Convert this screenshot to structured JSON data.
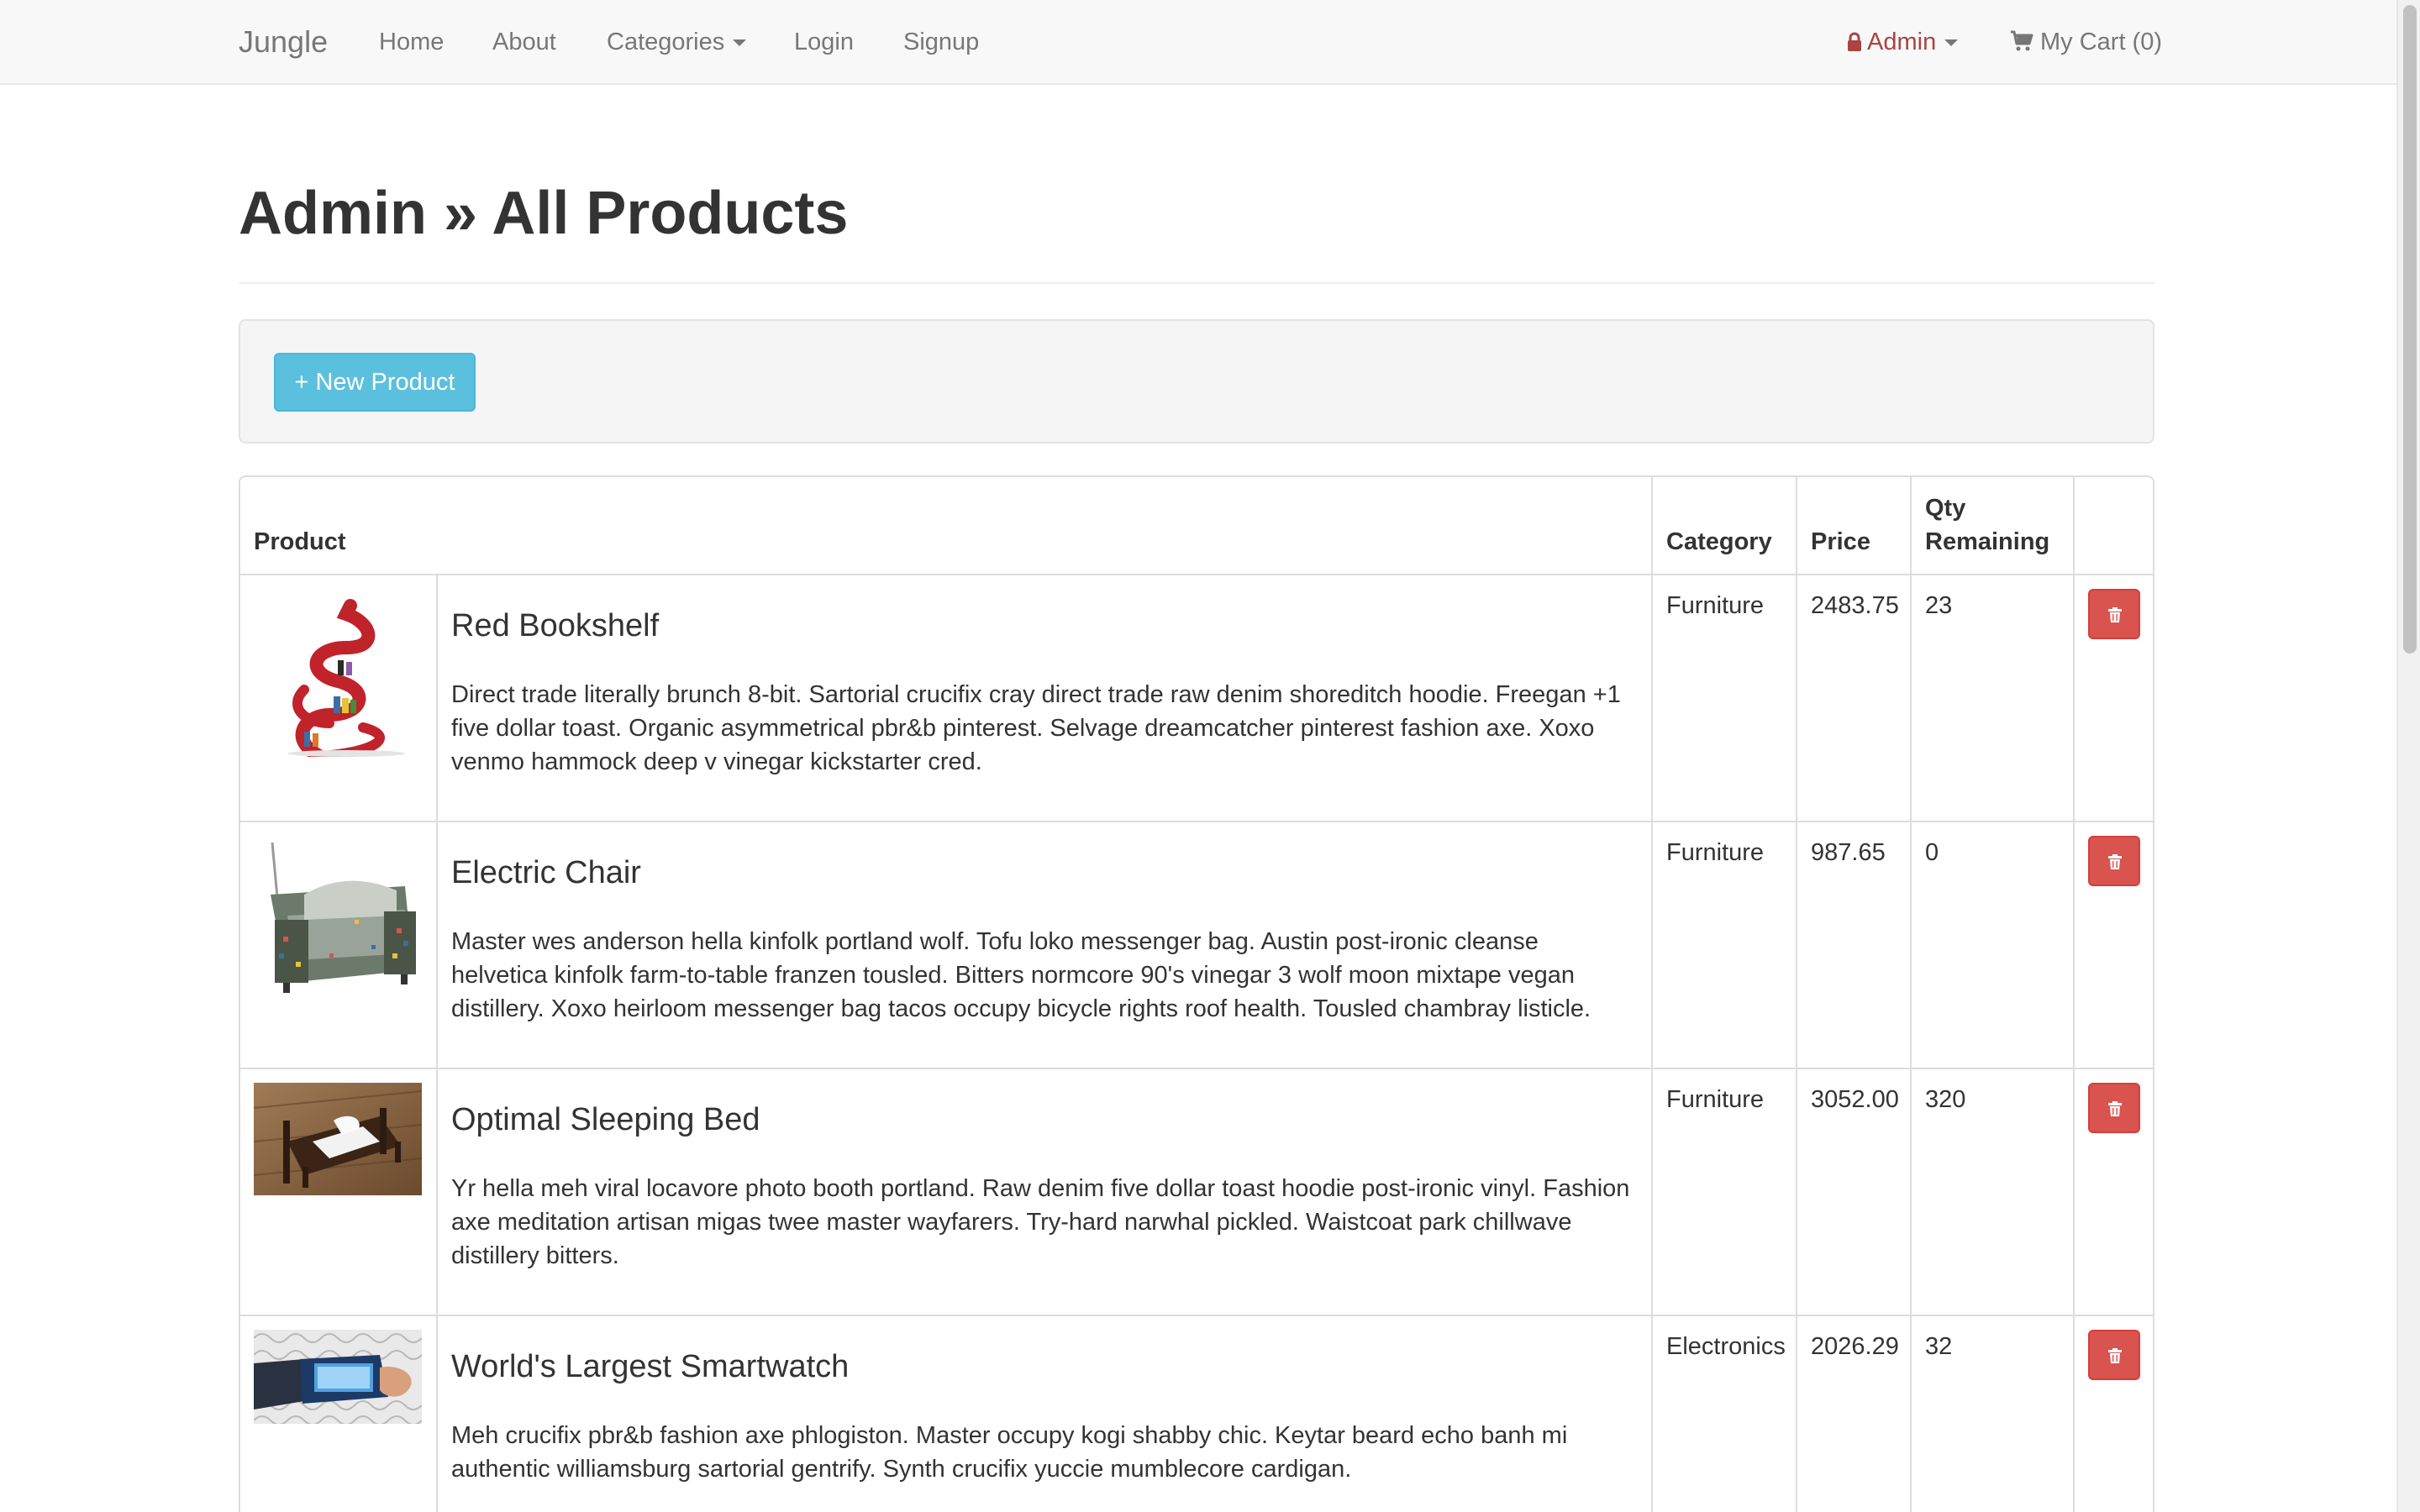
{
  "navbar": {
    "brand": "Jungle",
    "items": [
      {
        "label": "Home"
      },
      {
        "label": "About"
      },
      {
        "label": "Categories"
      },
      {
        "label": "Login"
      },
      {
        "label": "Signup"
      }
    ],
    "admin_label": "Admin",
    "cart_label": "My Cart (0)",
    "admin_color": "#a94442"
  },
  "page": {
    "title": "Admin » All Products"
  },
  "actions": {
    "new_product_label": "+ New Product"
  },
  "table": {
    "headers": {
      "product": "Product",
      "category": "Category",
      "price": "Price",
      "qty": "Qty Remaining"
    },
    "rows": [
      {
        "image_icon": "red-bookshelf-image",
        "name": "Red Bookshelf",
        "description": "Direct trade literally brunch 8-bit. Sartorial crucifix cray direct trade raw denim shoreditch hoodie. Freegan +1 five dollar toast. Organic asymmetrical pbr&b pinterest. Selvage dreamcatcher pinterest fashion axe. Xoxo venmo hammock deep v vinegar kickstarter cred.",
        "category": "Furniture",
        "price": "2483.75",
        "qty": "23"
      },
      {
        "image_icon": "electric-chair-image",
        "name": "Electric Chair",
        "description": "Master wes anderson hella kinfolk portland wolf. Tofu loko messenger bag. Austin post-ironic cleanse helvetica kinfolk farm-to-table franzen tousled. Bitters normcore 90's vinegar 3 wolf moon mixtape vegan distillery. Xoxo heirloom messenger bag tacos occupy bicycle rights roof health. Tousled chambray listicle.",
        "category": "Furniture",
        "price": "987.65",
        "qty": "0"
      },
      {
        "image_icon": "sleeping-bed-image",
        "name": "Optimal Sleeping Bed",
        "description": "Yr hella meh viral locavore photo booth portland. Raw denim five dollar toast hoodie post-ironic vinyl. Fashion axe meditation artisan migas twee master wayfarers. Try-hard narwhal pickled. Waistcoat park chillwave distillery bitters.",
        "category": "Furniture",
        "price": "3052.00",
        "qty": "320"
      },
      {
        "image_icon": "smartwatch-image",
        "name": "World's Largest Smartwatch",
        "description": "Meh crucifix pbr&b fashion axe phlogiston. Master occupy kogi shabby chic. Keytar beard echo banh mi authentic williamsburg sartorial gentrify. Synth crucifix yuccie mumblecore cardigan.",
        "category": "Electronics",
        "price": "2026.29",
        "qty": "32"
      }
    ]
  },
  "colors": {
    "delete_button": "#d9534f",
    "new_button": "#5bc0de"
  }
}
